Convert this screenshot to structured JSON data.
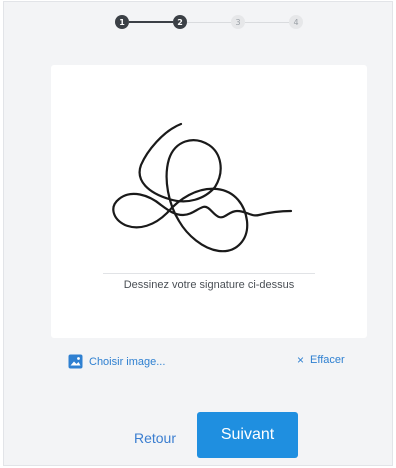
{
  "stepper": {
    "steps": [
      {
        "label": "1",
        "state": "done"
      },
      {
        "label": "2",
        "state": "done"
      },
      {
        "label": "3",
        "state": "todo"
      },
      {
        "label": "4",
        "state": "todo"
      }
    ]
  },
  "pad": {
    "hint": "Dessinez votre signature ci-dessus"
  },
  "tools": {
    "choose_image_label": "Choisir image...",
    "clear_label": "Effacer",
    "clear_icon": "×"
  },
  "footer": {
    "back_label": "Retour",
    "next_label": "Suivant"
  },
  "colors": {
    "accent": "#1f8fe0",
    "link": "#2f80d1",
    "step_done": "#3b4046"
  }
}
